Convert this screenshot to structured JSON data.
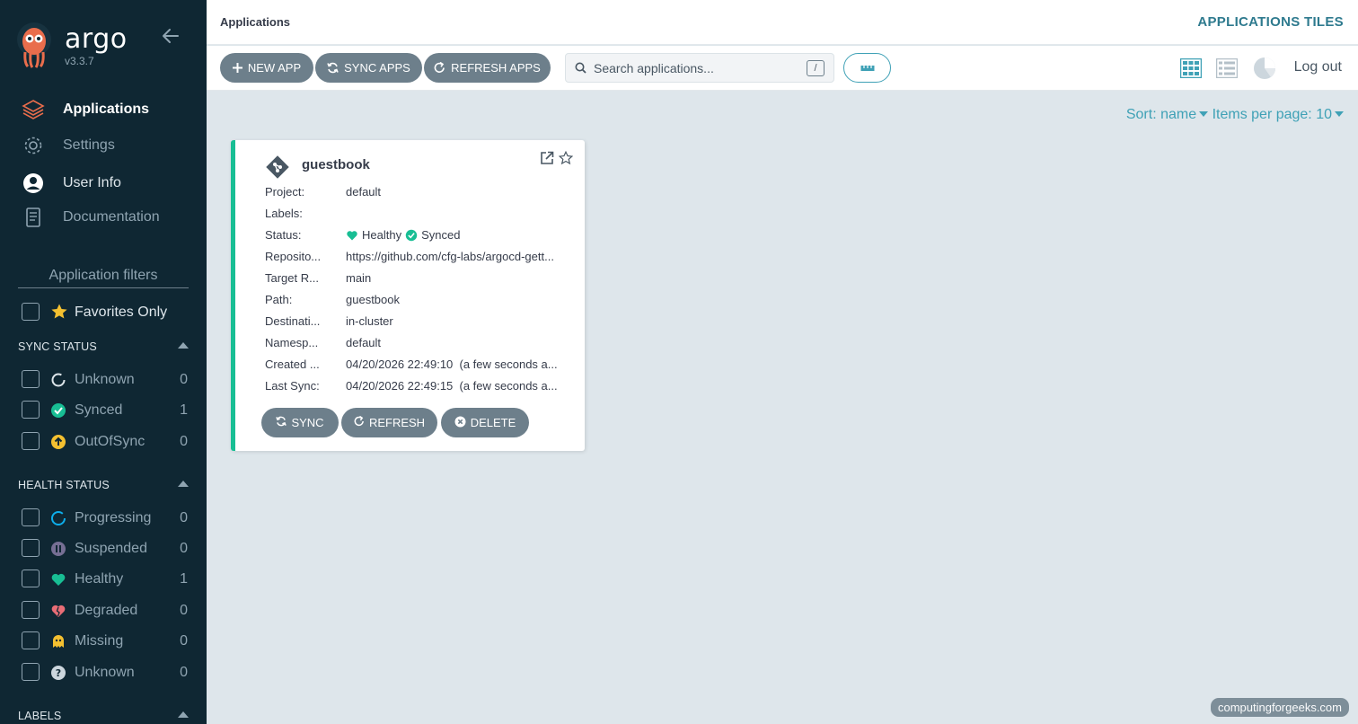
{
  "app": {
    "name": "argo",
    "version": "v3.3.7"
  },
  "nav": [
    {
      "label": "Applications",
      "icon": "layers-icon"
    },
    {
      "label": "Settings",
      "icon": "gear-icon"
    },
    {
      "label": "User Info",
      "icon": "user-icon"
    },
    {
      "label": "Documentation",
      "icon": "book-icon"
    }
  ],
  "filters": {
    "title": "Application filters",
    "favorites_label": "Favorites Only",
    "sync_status": {
      "title": "SYNC STATUS",
      "items": [
        {
          "label": "Unknown",
          "count": "0",
          "icon": "circle-outline-icon"
        },
        {
          "label": "Synced",
          "count": "1",
          "icon": "check-circle-icon"
        },
        {
          "label": "OutOfSync",
          "count": "0",
          "icon": "arrow-up-circle-icon"
        }
      ]
    },
    "health_status": {
      "title": "HEALTH STATUS",
      "items": [
        {
          "label": "Progressing",
          "count": "0",
          "icon": "progress-circle-icon"
        },
        {
          "label": "Suspended",
          "count": "0",
          "icon": "pause-circle-icon"
        },
        {
          "label": "Healthy",
          "count": "1",
          "icon": "heart-icon"
        },
        {
          "label": "Degraded",
          "count": "0",
          "icon": "broken-heart-icon"
        },
        {
          "label": "Missing",
          "count": "0",
          "icon": "ghost-icon"
        },
        {
          "label": "Unknown",
          "count": "0",
          "icon": "question-circle-icon"
        }
      ]
    },
    "labels": {
      "title": "LABELS"
    }
  },
  "header": {
    "breadcrumb": "Applications",
    "page_mode": "APPLICATIONS TILES"
  },
  "toolbar": {
    "new_app": "NEW APP",
    "sync_apps": "SYNC APPS",
    "refresh_apps": "REFRESH APPS",
    "search_placeholder": "Search applications...",
    "search_shortcut": "/",
    "logout": "Log out"
  },
  "sort": {
    "sort_label": "Sort: name",
    "per_page_label": "Items per page: 10"
  },
  "card": {
    "name": "guestbook",
    "fields": {
      "project": {
        "label": "Project:",
        "value": "default"
      },
      "labels": {
        "label": "Labels:",
        "value": ""
      },
      "status": {
        "label": "Status:",
        "health": "Healthy",
        "sync": "Synced"
      },
      "repository": {
        "label": "Reposito...",
        "value": "https://github.com/cfg-labs/argocd-gett..."
      },
      "target_revision": {
        "label": "Target R...",
        "value": "main"
      },
      "path": {
        "label": "Path:",
        "value": "guestbook"
      },
      "destination": {
        "label": "Destinati...",
        "value": "in-cluster"
      },
      "namespace": {
        "label": "Namesp...",
        "value": "default"
      },
      "created": {
        "label": "Created ...",
        "value": "04/20/2026 22:49:10  (a few seconds a..."
      },
      "last_sync": {
        "label": "Last Sync:",
        "value": "04/20/2026 22:49:15  (a few seconds a..."
      }
    },
    "buttons": {
      "sync": "SYNC",
      "refresh": "REFRESH",
      "delete": "DELETE"
    }
  },
  "watermark": "computingforgeeks.com",
  "colors": {
    "sidebar_bg": "#0f2733",
    "accent": "#3fa1b6",
    "healthy": "#18be94",
    "button_bg": "#6d7f8b",
    "out_of_sync": "#f4c030",
    "degraded": "#e96d76",
    "suspended": "#766f94"
  }
}
